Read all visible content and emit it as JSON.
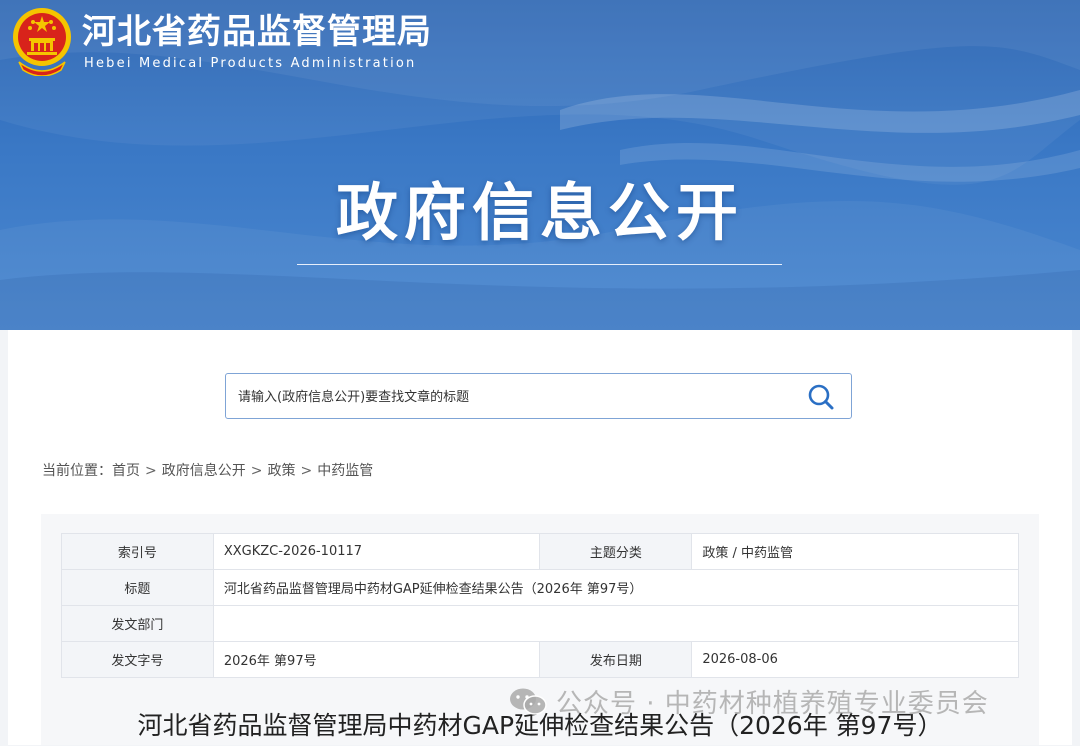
{
  "brand": {
    "name_cn": "河北省药品监督管理局",
    "name_en": "Hebei Medical Products Administration"
  },
  "hero": {
    "title": "政府信息公开"
  },
  "search": {
    "placeholder": "请输入(政府信息公开)要查找文章的标题"
  },
  "breadcrumb": {
    "prefix": "当前位置：",
    "sep": ">",
    "items": [
      "首页",
      "政府信息公开",
      "政策",
      "中药监管"
    ]
  },
  "meta": {
    "index_label": "索引号",
    "index_value": "XXGKZC-2026-10117",
    "topic_label": "主题分类",
    "topic_value": "政策 / 中药监管",
    "title_label": "标题",
    "title_value": "河北省药品监督管理局中药材GAP延伸检查结果公告（2026年 第97号）",
    "dept_label": "发文部门",
    "dept_value": "",
    "docno_label": "发文字号",
    "docno_value": "2026年 第97号",
    "date_label": "发布日期",
    "date_value": "2026-08-06"
  },
  "article": {
    "title": "河北省药品监督管理局中药材GAP延伸检查结果公告（2026年 第97号）"
  },
  "watermark": {
    "text": "公众号 · 中药材种植养殖专业委员会"
  },
  "colors": {
    "banner_top": "#2a64b2",
    "banner_bottom": "#4b88d0",
    "search_border": "#7fa4d6",
    "search_icon": "#2a6fc4",
    "emblem_red": "#d8231b",
    "emblem_gold": "#f5c400"
  },
  "icons": {
    "search": "search-icon",
    "emblem": "national-emblem-icon",
    "watermark": "wechat-icon"
  }
}
